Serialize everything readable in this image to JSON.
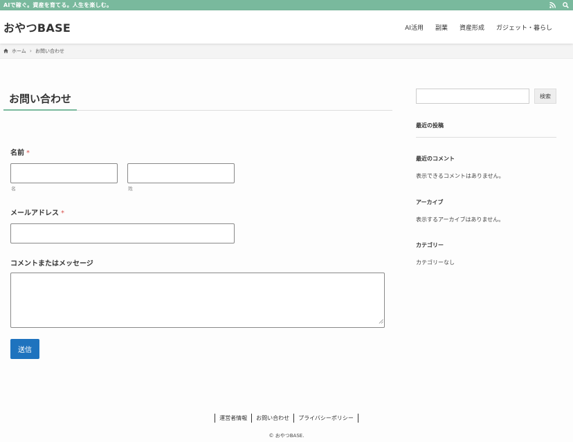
{
  "topbar": {
    "tagline": "AIで稼ぐ。資産を育てる。人生を楽しむ。",
    "rss_icon": "rss-icon",
    "search_icon": "search-icon",
    "color": "#79b99d"
  },
  "header": {
    "site_title": "おやつBASE",
    "nav": [
      "AI活用",
      "副業",
      "資産形成",
      "ガジェット・暮らし"
    ]
  },
  "breadcrumb": {
    "home_icon": "home-icon",
    "home": "ホーム",
    "separator": "›",
    "current": "お問い合わせ"
  },
  "main": {
    "page_title": "お問い合わせ",
    "form": {
      "name_label": "名前",
      "required_mark": "*",
      "first_sub": "名",
      "last_sub": "姓",
      "email_label": "メールアドレス",
      "comment_label": "コメントまたはメッセージ",
      "submit": "送信",
      "submit_color": "#1e73be"
    }
  },
  "sidebar": {
    "search_button": "検索",
    "recent_posts_title": "最近の投稿",
    "recent_comments_title": "最近のコメント",
    "recent_comments_empty": "表示できるコメントはありません。",
    "archives_title": "アーカイブ",
    "archives_empty": "表示するアーカイブはありません。",
    "categories_title": "カテゴリー",
    "categories_empty": "カテゴリーなし"
  },
  "footer": {
    "links": [
      "運営者情報",
      "お問い合わせ",
      "プライバシーポリシー"
    ],
    "copyright": "© おやつBASE."
  }
}
